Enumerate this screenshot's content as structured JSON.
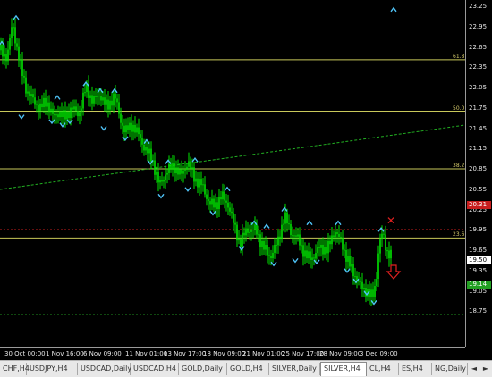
{
  "price_scale": {
    "labels": [
      "23.25",
      "22.95",
      "22.65",
      "22.35",
      "22.05",
      "21.75",
      "21.45",
      "21.15",
      "20.85",
      "20.55",
      "20.25",
      "19.95",
      "19.65",
      "19.35",
      "19.05",
      "18.75"
    ],
    "highlights": [
      {
        "label": "20.31",
        "value": 20.31,
        "bg": "#c81e1e",
        "fg": "#ffffff"
      },
      {
        "label": "19.50",
        "value": 19.5,
        "bg": "#ffffff",
        "fg": "#000000"
      },
      {
        "label": "19.14",
        "value": 19.14,
        "bg": "#22a022",
        "fg": "#ffffff"
      }
    ]
  },
  "levels": [
    {
      "label": "61.8",
      "value": 22.46,
      "color": "#c8c85a"
    },
    {
      "label": "50.0",
      "value": 21.7,
      "color": "#c8c85a"
    },
    {
      "label": "38.2",
      "value": 20.85,
      "color": "#c8c85a"
    },
    {
      "label": "23.6",
      "value": 19.83,
      "color": "#c8c85a"
    }
  ],
  "time_axis": [
    {
      "label": "30 Oct 00:00"
    },
    {
      "label": "1 Nov 16:00"
    },
    {
      "label": "6 Nov 09:00"
    },
    {
      "label": "11 Nov 01:00"
    },
    {
      "label": "13 Nov 17:00"
    },
    {
      "label": "18 Nov 09:00"
    },
    {
      "label": "21 Nov 01:00"
    },
    {
      "label": "25 Nov 17:00"
    },
    {
      "label": "28 Nov 09:00"
    },
    {
      "label": "3 Dec 09:00"
    }
  ],
  "tabs": [
    {
      "label": "CHF,H4",
      "active": false
    },
    {
      "label": "USDJPY,H4",
      "active": false
    },
    {
      "label": "USDCAD,Daily",
      "active": false
    },
    {
      "label": "USDCAD,H4",
      "active": false
    },
    {
      "label": "GOLD,Daily",
      "active": false
    },
    {
      "label": "GOLD,H4",
      "active": false
    },
    {
      "label": "SILVER,Daily",
      "active": false
    },
    {
      "label": "SILVER,H4",
      "active": true
    },
    {
      "label": "CL,H4",
      "active": false
    },
    {
      "label": "ES,H4",
      "active": false
    },
    {
      "label": "NG,Daily",
      "active": false
    }
  ],
  "nav": {
    "left": "◄",
    "right": "►"
  },
  "colors": {
    "candle": "#00e600",
    "arrow": "#4fc3f7",
    "trendline": "#22b022",
    "red_line": "#c81e1e",
    "level": "#c8c85a"
  }
}
